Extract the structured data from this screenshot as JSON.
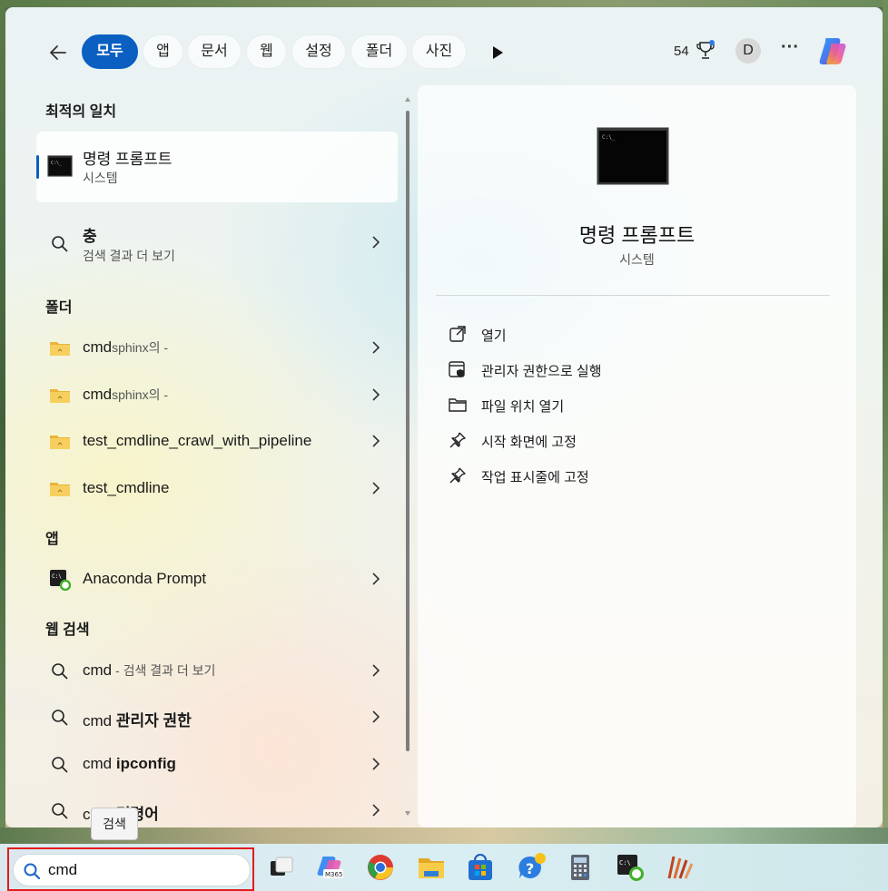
{
  "filter_bar": {
    "chips": [
      "모두",
      "앱",
      "문서",
      "웹",
      "설정",
      "폴더",
      "사진"
    ],
    "points": "54",
    "avatar_initial": "D"
  },
  "left": {
    "best_match_title": "최적의 일치",
    "best_match": {
      "name": "명령 프롬프트",
      "sub": "시스템"
    },
    "search_row": {
      "label": "충",
      "sub": "검색 결과 더 보기"
    },
    "folders_title": "폴더",
    "folders": [
      {
        "name": "cmd",
        "suffix": "sphinx의 -"
      },
      {
        "name": "cmd",
        "suffix": "sphinx의 -"
      },
      {
        "name": "test_cmdline_crawl_with_pipeline",
        "suffix": ""
      },
      {
        "name": "test_cmdline",
        "suffix": ""
      }
    ],
    "apps_title": "앱",
    "apps": [
      {
        "name": "Anaconda Prompt"
      }
    ],
    "web_title": "웹 검색",
    "web": [
      {
        "prefix": "cmd",
        "bold": "",
        "suffix": " - 검색 결과 더 보기"
      },
      {
        "prefix": "cmd ",
        "bold": "관리자 권한",
        "suffix": ""
      },
      {
        "prefix": "cmd ",
        "bold": "ipconfig",
        "suffix": ""
      },
      {
        "prefix": "cmd ",
        "bold": "명령어",
        "suffix": ""
      }
    ]
  },
  "detail": {
    "title": "명령 프롬프트",
    "subtitle": "시스템",
    "actions": [
      {
        "icon": "open-external-icon",
        "label": "열기"
      },
      {
        "icon": "shield-icon",
        "label": "관리자 권한으로 실행"
      },
      {
        "icon": "folder-icon",
        "label": "파일 위치 열기"
      },
      {
        "icon": "pin-icon",
        "label": "시작 화면에 고정"
      },
      {
        "icon": "pin-icon",
        "label": "작업 표시줄에 고정"
      }
    ]
  },
  "tooltip": "검색",
  "taskbar": {
    "search_value": "cmd",
    "apps": [
      "task-view-icon",
      "m365-copilot-icon",
      "chrome-icon",
      "file-explorer-icon",
      "microsoft-store-icon",
      "get-help-icon",
      "calculator-icon",
      "anaconda-prompt-icon",
      "sublime-merge-icon"
    ],
    "m365_label": "M365"
  },
  "colors": {
    "accent": "#0a5fc0",
    "highlight_border": "#e21c1c"
  }
}
